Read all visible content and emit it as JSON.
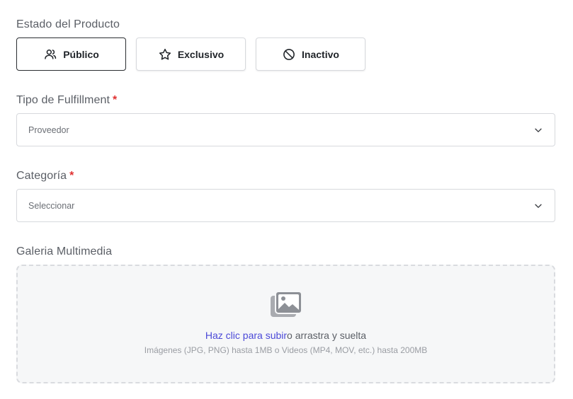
{
  "status": {
    "label": "Estado del Producto",
    "options": [
      {
        "label": "Público",
        "icon": "users-icon",
        "selected": true
      },
      {
        "label": "Exclusivo",
        "icon": "star-icon",
        "selected": false
      },
      {
        "label": "Inactivo",
        "icon": "ban-icon",
        "selected": false
      }
    ]
  },
  "fulfillment": {
    "label": "Tipo de Fulfillment",
    "required_mark": "*",
    "value": "Proveedor"
  },
  "category": {
    "label": "Categoría",
    "required_mark": "*",
    "value": "Seleccionar"
  },
  "gallery": {
    "label": "Galeria Multimedia",
    "upload_link": "Haz clic para subir",
    "upload_text": "o arrastra y suelta",
    "hint": "Imágenes (JPG, PNG) hasta 1MB o Videos (MP4, MOV, etc.) hasta 200MB"
  },
  "colors": {
    "accent_link": "#4b49d8",
    "required": "#e03131",
    "selected_border": "#2a2d31"
  }
}
